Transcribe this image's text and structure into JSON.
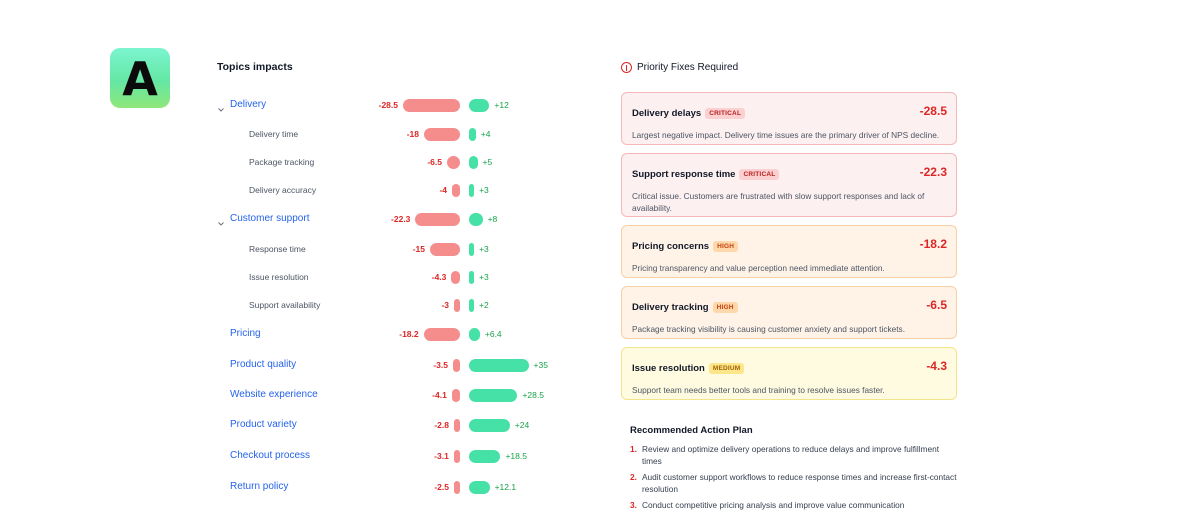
{
  "logo": {
    "letter": "A"
  },
  "topics": {
    "title": "Topics impacts",
    "rows": [
      {
        "label": "Delivery",
        "level": "main",
        "expandable": true,
        "neg": -28.5,
        "pos": 12,
        "neg_text": "-28.5",
        "pos_text": "+12"
      },
      {
        "label": "Delivery time",
        "level": "sub",
        "neg": -18,
        "pos": 4,
        "neg_text": "-18",
        "pos_text": "+4"
      },
      {
        "label": "Package tracking",
        "level": "sub",
        "neg": -6.5,
        "pos": 5,
        "neg_text": "-6.5",
        "pos_text": "+5"
      },
      {
        "label": "Delivery accuracy",
        "level": "sub",
        "neg": -4,
        "pos": 3,
        "neg_text": "-4",
        "pos_text": "+3"
      },
      {
        "label": "Customer support",
        "level": "main",
        "expandable": true,
        "neg": -22.3,
        "pos": 8,
        "neg_text": "-22.3",
        "pos_text": "+8"
      },
      {
        "label": "Response time",
        "level": "sub",
        "neg": -15,
        "pos": 3,
        "neg_text": "-15",
        "pos_text": "+3"
      },
      {
        "label": "Issue resolution",
        "level": "sub",
        "neg": -4.3,
        "pos": 3,
        "neg_text": "-4.3",
        "pos_text": "+3"
      },
      {
        "label": "Support availability",
        "level": "sub",
        "neg": -3,
        "pos": 2,
        "neg_text": "-3",
        "pos_text": "+2"
      },
      {
        "label": "Pricing",
        "level": "main",
        "expandable": false,
        "neg": -18.2,
        "pos": 6.4,
        "neg_text": "-18.2",
        "pos_text": "+6.4"
      },
      {
        "label": "Product quality",
        "level": "main",
        "expandable": false,
        "neg": -3.5,
        "pos": 35,
        "neg_text": "-3.5",
        "pos_text": "+35"
      },
      {
        "label": "Website experience",
        "level": "main",
        "expandable": false,
        "neg": -4.1,
        "pos": 28.5,
        "neg_text": "-4.1",
        "pos_text": "+28.5"
      },
      {
        "label": "Product variety",
        "level": "main",
        "expandable": false,
        "neg": -2.8,
        "pos": 24,
        "neg_text": "-2.8",
        "pos_text": "+24"
      },
      {
        "label": "Checkout process",
        "level": "main",
        "expandable": false,
        "neg": -3.1,
        "pos": 18.5,
        "neg_text": "-3.1",
        "pos_text": "+18.5"
      },
      {
        "label": "Return policy",
        "level": "main",
        "expandable": false,
        "neg": -2.5,
        "pos": 12.1,
        "neg_text": "-2.5",
        "pos_text": "+12.1"
      }
    ]
  },
  "priority": {
    "title": "Priority Fixes Required",
    "cards": [
      {
        "title": "Delivery delays",
        "severity": "critical",
        "badge": "CRITICAL",
        "value": "-28.5",
        "desc": "Largest negative impact. Delivery time issues are the primary driver of NPS decline."
      },
      {
        "title": "Support response time",
        "severity": "critical",
        "badge": "CRITICAL",
        "value": "-22.3",
        "desc": "Critical issue. Customers are frustrated with slow support responses and lack of availability."
      },
      {
        "title": "Pricing concerns",
        "severity": "high",
        "badge": "HIGH",
        "value": "-18.2",
        "desc": "Pricing transparency and value perception need immediate attention."
      },
      {
        "title": "Delivery tracking",
        "severity": "high",
        "badge": "HIGH",
        "value": "-6.5",
        "desc": "Package tracking visibility is causing customer anxiety and support tickets."
      },
      {
        "title": "Issue resolution",
        "severity": "medium",
        "badge": "MEDIUM",
        "value": "-4.3",
        "desc": "Support team needs better tools and training to resolve issues faster."
      }
    ]
  },
  "plan": {
    "title": "Recommended Action Plan",
    "items": [
      {
        "num": "1.",
        "text": "Review and optimize delivery operations to reduce delays and improve fulfillment times"
      },
      {
        "num": "2.",
        "text": "Audit customer support workflows to reduce response times and increase first-contact resolution"
      },
      {
        "num": "3.",
        "text": "Conduct competitive pricing analysis and improve value communication"
      }
    ]
  }
}
